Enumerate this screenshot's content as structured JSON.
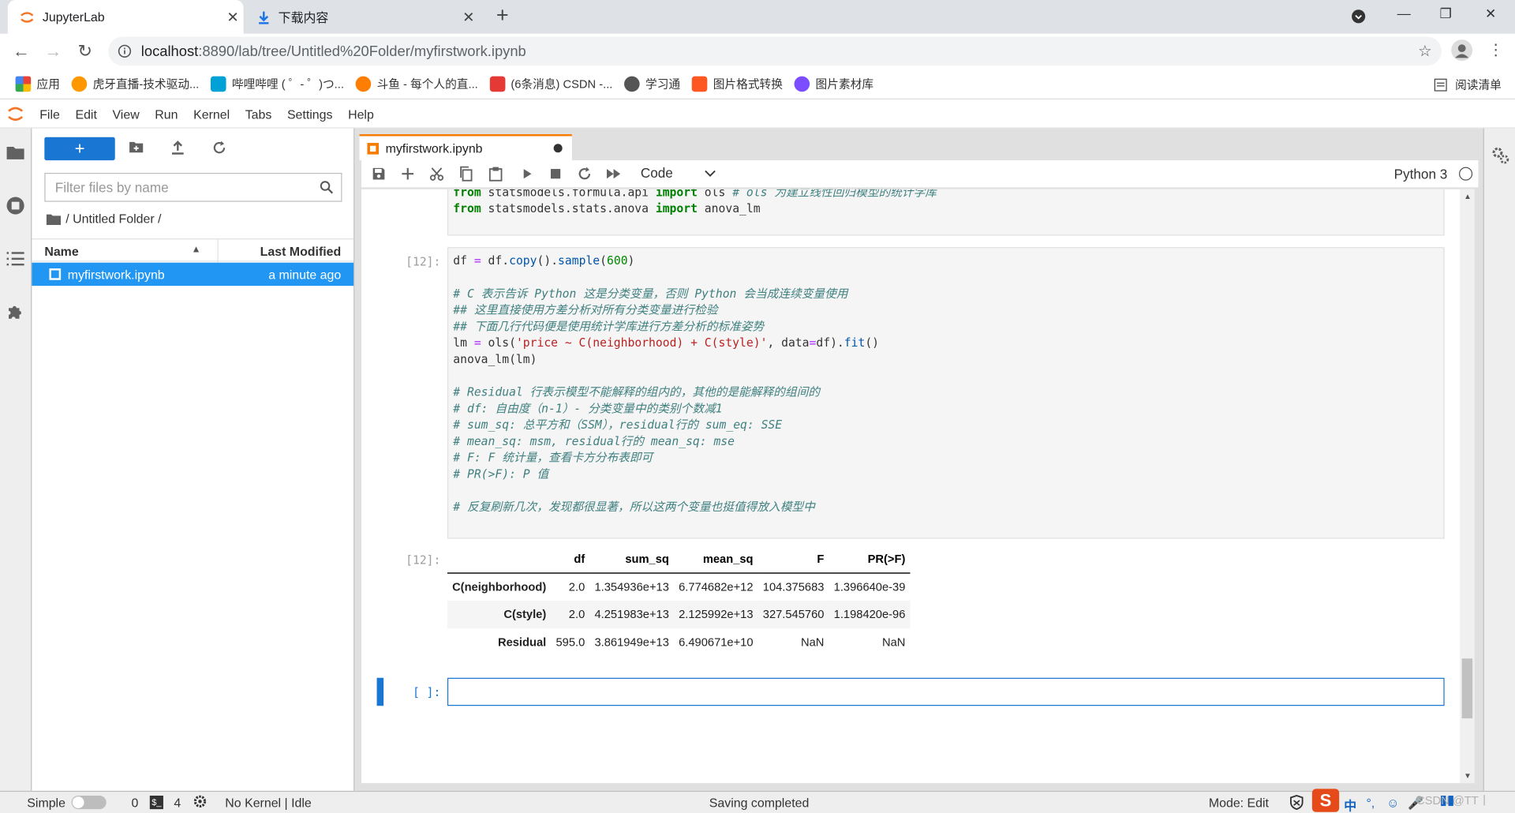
{
  "browser": {
    "tabs": [
      {
        "title": "JupyterLab",
        "active": true
      },
      {
        "title": "下载内容",
        "active": false
      }
    ],
    "url": {
      "host": "localhost",
      "rest": ":8890/lab/tree/Untitled%20Folder/myfirstwork.ipynb"
    },
    "bookmarks": [
      {
        "label": "应用",
        "color": "#e91e63"
      },
      {
        "label": "虎牙直播-技术驱动...",
        "color": "#ff9800"
      },
      {
        "label": "哔哩哔哩 ( ゜- ゜)つ...",
        "color": "#00a1d6"
      },
      {
        "label": "斗鱼 - 每个人的直...",
        "color": "#ff7d00"
      },
      {
        "label": "(6条消息) CSDN -...",
        "color": "#e53935"
      },
      {
        "label": "学习通",
        "color": "#555555"
      },
      {
        "label": "图片格式转换",
        "color": "#ff5722"
      },
      {
        "label": "图片素材库",
        "color": "#7c4dff"
      }
    ],
    "reading_list": "阅读清单"
  },
  "jupyter": {
    "menu": [
      "File",
      "Edit",
      "View",
      "Run",
      "Kernel",
      "Tabs",
      "Settings",
      "Help"
    ],
    "filebrowser": {
      "filter_placeholder": "Filter files by name",
      "breadcrumb": "/ Untitled Folder /",
      "col_name": "Name",
      "col_modified": "Last Modified",
      "files": [
        {
          "name": "myfirstwork.ipynb",
          "modified": "a minute ago"
        }
      ]
    },
    "notebook_tab": "myfirstwork.ipynb",
    "cell_type": "Code",
    "kernel_name": "Python 3",
    "cells": {
      "top_lines": [
        "from statsmodels.formula.api import ols # ols 为建立线性回归模型的统计学库",
        "from statsmodels.stats.anova import anova_lm"
      ],
      "cell12_prompt": "[12]:",
      "cell12_lines": [
        "df = df.copy().sample(600)",
        "",
        "# C 表示告诉 Python 这是分类变量，否则 Python 会当成连续变量使用",
        "## 这里直接使用方差分析对所有分类变量进行检验",
        "## 下面几行代码便是使用统计学库进行方差分析的标准姿势",
        "lm = ols('price ~ C(neighborhood) + C(style)', data=df).fit()",
        "anova_lm(lm)",
        "",
        "# Residual 行表示模型不能解释的组内的，其他的是能解释的组间的",
        "# df: 自由度（n-1）- 分类变量中的类别个数减1",
        "# sum_sq: 总平方和（SSM），residual行的 sum_eq: SSE",
        "# mean_sq: msm, residual行的 mean_sq: mse",
        "# F: F 统计量，查看卡方分布表即可",
        "# PR(>F): P 值",
        "",
        "# 反复刷新几次，发现都很显著，所以这两个变量也挺值得放入模型中"
      ],
      "output_prompt": "[12]:",
      "table": {
        "columns": [
          "",
          "df",
          "sum_sq",
          "mean_sq",
          "F",
          "PR(>F)"
        ],
        "rows": [
          [
            "C(neighborhood)",
            "2.0",
            "1.354936e+13",
            "6.774682e+12",
            "104.375683",
            "1.396640e-39"
          ],
          [
            "C(style)",
            "2.0",
            "4.251983e+13",
            "2.125992e+13",
            "327.545760",
            "1.198420e-96"
          ],
          [
            "Residual",
            "595.0",
            "3.861949e+13",
            "6.490671e+10",
            "NaN",
            "NaN"
          ]
        ]
      },
      "empty_prompt": "[ ]:"
    },
    "status": {
      "mode_label": "Simple",
      "terminals": "0",
      "kernels": "4",
      "kernel_state": "No Kernel | Idle",
      "message": "Saving completed",
      "mode": "Mode: Edit"
    },
    "ime": {
      "lang": "中",
      "watermark": "CSDN @TT丨"
    }
  }
}
